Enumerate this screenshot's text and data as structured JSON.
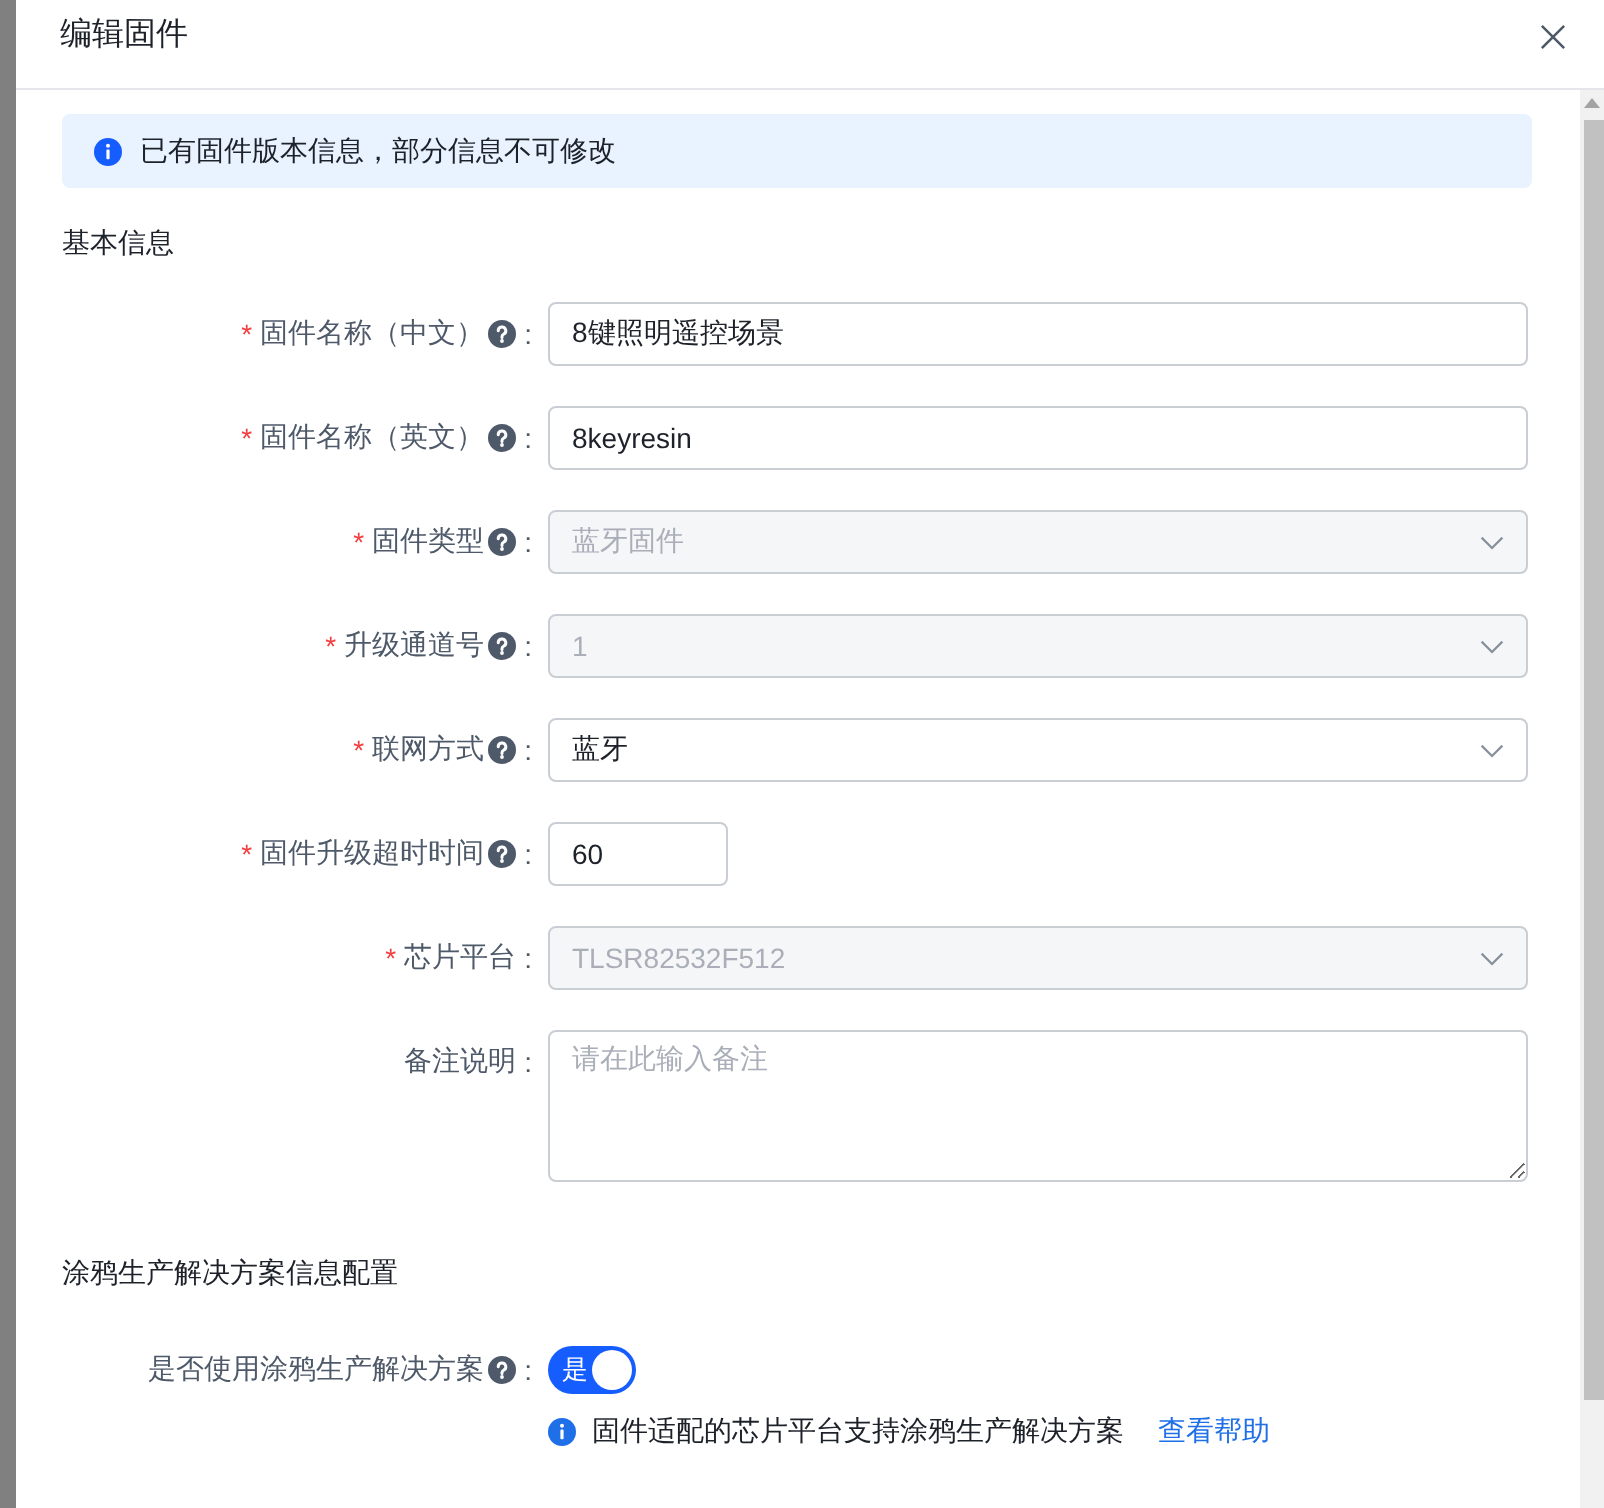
{
  "dialog": {
    "title": "编辑固件"
  },
  "alert": {
    "text": "已有固件版本信息，部分信息不可修改"
  },
  "sections": [
    {
      "title": "基本信息",
      "fields": [
        {
          "kind": "text",
          "required_mark": "*",
          "label": "固件名称（中文）",
          "help": true,
          "colon": ":",
          "value": "8键照明遥控场景",
          "disabled": false
        },
        {
          "kind": "text",
          "required_mark": "*",
          "label": "固件名称（英文）",
          "help": true,
          "colon": ":",
          "value": "8keyresin",
          "disabled": false
        },
        {
          "kind": "select",
          "required_mark": "*",
          "label": "固件类型",
          "help": true,
          "colon": ":",
          "value": "蓝牙固件",
          "disabled": true
        },
        {
          "kind": "select",
          "required_mark": "*",
          "label": "升级通道号",
          "help": true,
          "colon": ":",
          "value": "1",
          "disabled": true
        },
        {
          "kind": "select",
          "required_mark": "*",
          "label": "联网方式",
          "help": true,
          "colon": ":",
          "value": "蓝牙",
          "disabled": false
        },
        {
          "kind": "number",
          "required_mark": "*",
          "label": "固件升级超时时间",
          "help": true,
          "colon": ":",
          "value": "60",
          "disabled": false
        },
        {
          "kind": "select",
          "required_mark": "*",
          "label": "芯片平台",
          "help": false,
          "colon": ":",
          "value": "TLSR82532F512",
          "disabled": true
        },
        {
          "kind": "textarea",
          "label": "备注说明",
          "help": false,
          "colon": ":",
          "placeholder": "请在此输入备注",
          "disabled": false
        }
      ]
    },
    {
      "title": "涂鸦生产解决方案信息配置",
      "fields": [
        {
          "kind": "switch",
          "label": "是否使用涂鸦生产解决方案",
          "help": true,
          "colon": ":",
          "on": true,
          "on_text": "是",
          "hint": {
            "text": "固件适配的芯片平台支持涂鸦生产解决方案",
            "link": "查看帮助"
          }
        }
      ]
    }
  ]
}
